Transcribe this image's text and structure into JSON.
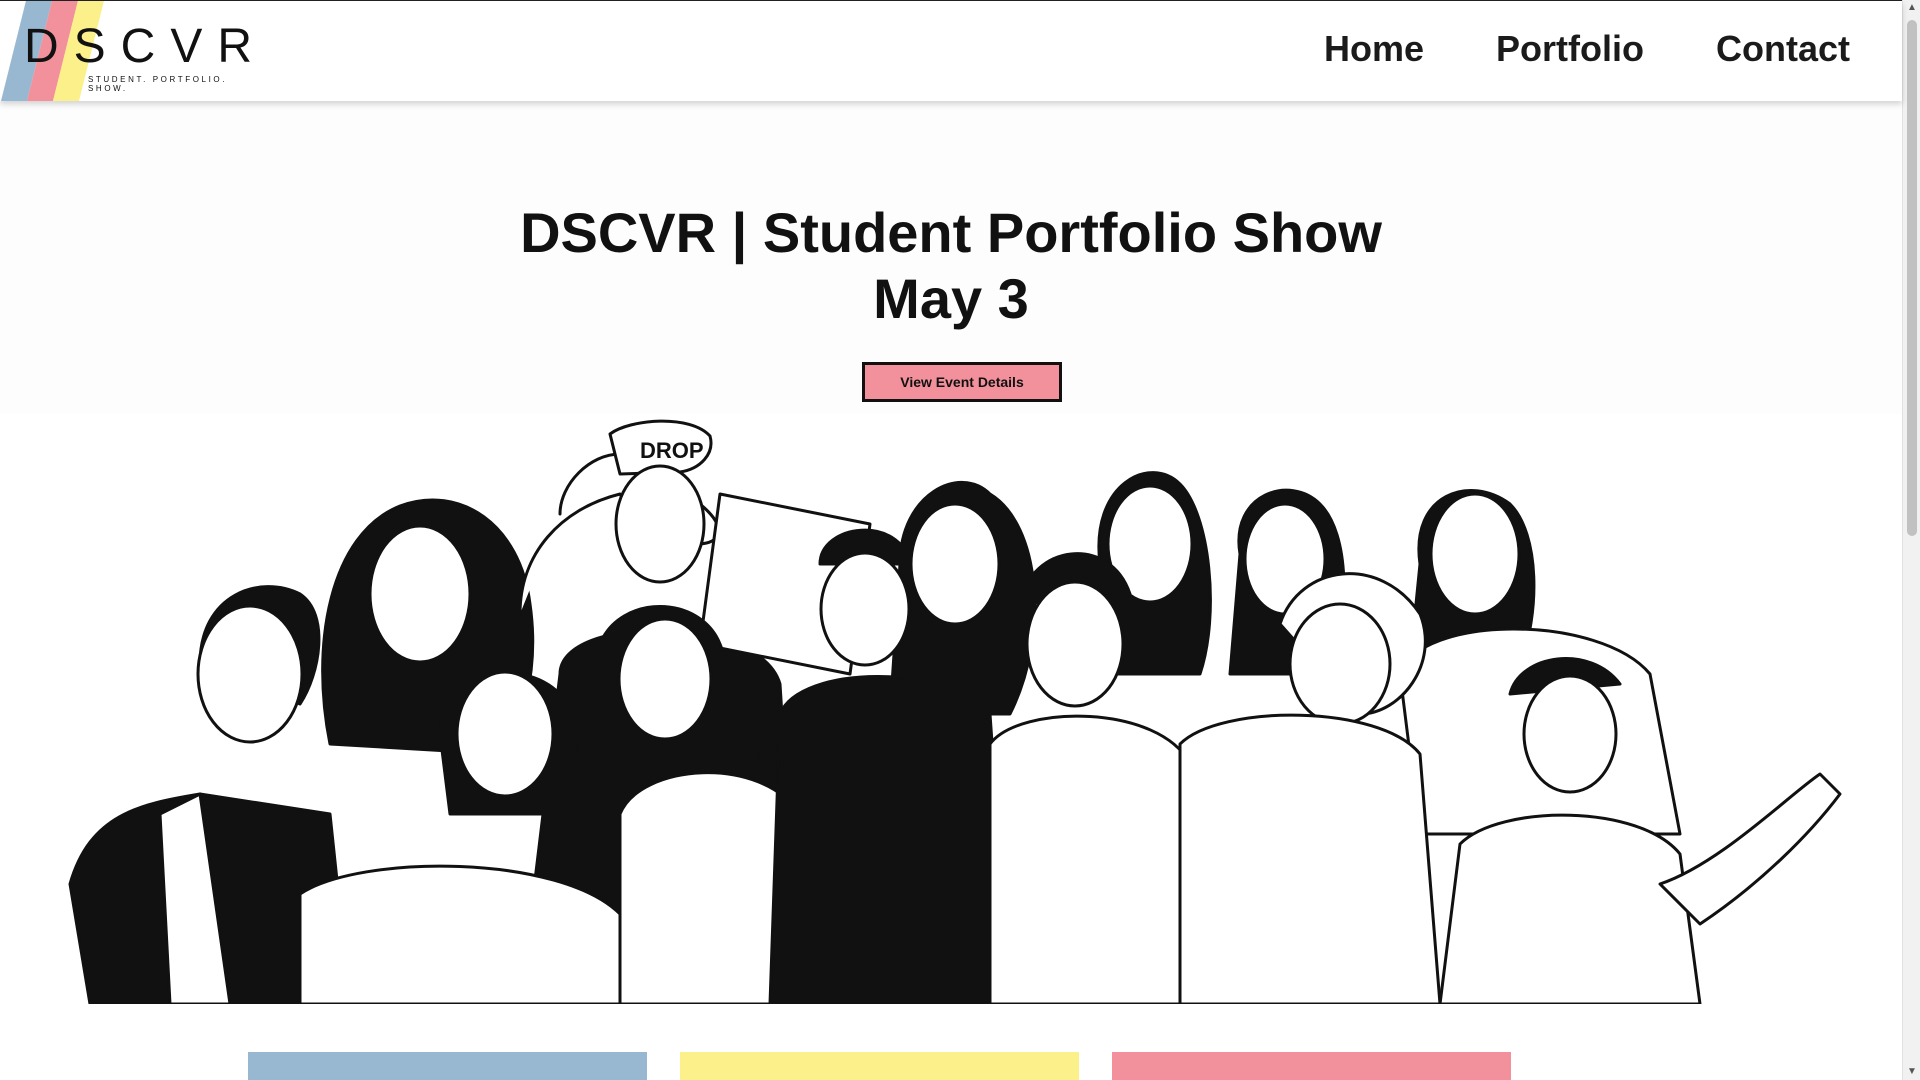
{
  "brand": {
    "name": "DSCVR",
    "tagline": "STUDENT. PORTFOLIO. SHOW.",
    "colors": {
      "blue": "#98b8d2",
      "pink": "#f2919b",
      "yellow": "#fbf08a"
    }
  },
  "nav": {
    "items": [
      {
        "label": "Home"
      },
      {
        "label": "Portfolio"
      },
      {
        "label": "Contact"
      }
    ]
  },
  "hero": {
    "title_line1": "DSCVR | Student Portfolio Show",
    "title_line2": "May 3",
    "button_label": "View Event Details",
    "button_color": "#f2919b",
    "illustration_cap_text": "DROP"
  },
  "cards": [
    {
      "color": "#98b8d2"
    },
    {
      "color": "#fbf08a"
    },
    {
      "color": "#f2919b"
    }
  ],
  "scrollbar": {
    "up_icon": "▲",
    "down_icon": "▼"
  }
}
